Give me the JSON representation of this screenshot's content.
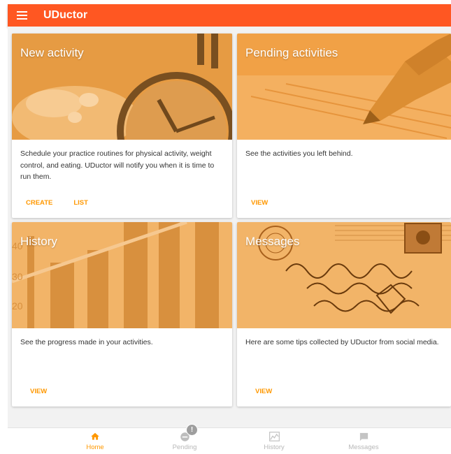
{
  "app": {
    "title": "UDuctor"
  },
  "cards": [
    {
      "title": "New activity",
      "text": "Schedule your practice routines for physical activity, weight control, and eating. UDuctor will notify you when it is time to run them.",
      "actions": [
        "CREATE",
        "LIST"
      ]
    },
    {
      "title": "Pending activities",
      "text": "See the activities you left behind.",
      "actions": [
        "VIEW"
      ]
    },
    {
      "title": "History",
      "text": "See the progress made in your activities.",
      "actions": [
        "VIEW"
      ],
      "axis_labels": [
        "40",
        "30",
        "20"
      ]
    },
    {
      "title": "Messages",
      "text": "Here are some tips collected by UDuctor from social media.",
      "actions": [
        "VIEW"
      ]
    }
  ],
  "bottom_nav": {
    "items": [
      {
        "label": "Home",
        "icon": "home-icon",
        "active": true
      },
      {
        "label": "Pending",
        "icon": "pending-icon",
        "active": false,
        "badge": "!"
      },
      {
        "label": "History",
        "icon": "history-chart-icon",
        "active": false
      },
      {
        "label": "Messages",
        "icon": "messages-icon",
        "active": false
      }
    ]
  },
  "colors": {
    "appbar": "#ff5722",
    "accent": "#ff9800",
    "media_overlay": "#f0a040",
    "inactive_nav": "#b8b8b8"
  }
}
